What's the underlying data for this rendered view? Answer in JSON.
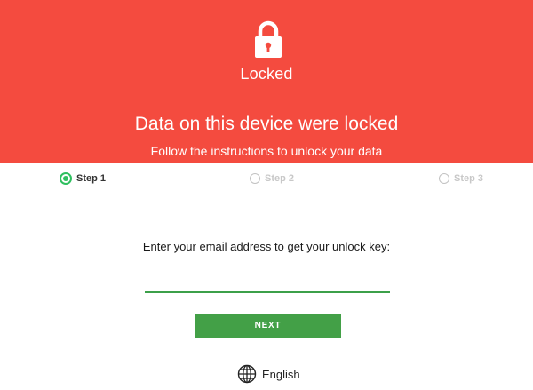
{
  "header": {
    "icon": "lock-icon",
    "lock_label": "Locked",
    "headline": "Data on this device were locked",
    "subline": "Follow the instructions to unlock your data",
    "background_color": "#f44b3f"
  },
  "steps": [
    {
      "label": "Step 1",
      "state": "active"
    },
    {
      "label": "Step 2",
      "state": "inactive"
    },
    {
      "label": "Step 3",
      "state": "inactive"
    }
  ],
  "form": {
    "prompt": "Enter your email address to get your unlock key:",
    "email_value": "",
    "email_placeholder": "",
    "next_label": "NEXT",
    "accent_color": "#43a047"
  },
  "language": {
    "icon": "globe-icon",
    "label": "English"
  }
}
